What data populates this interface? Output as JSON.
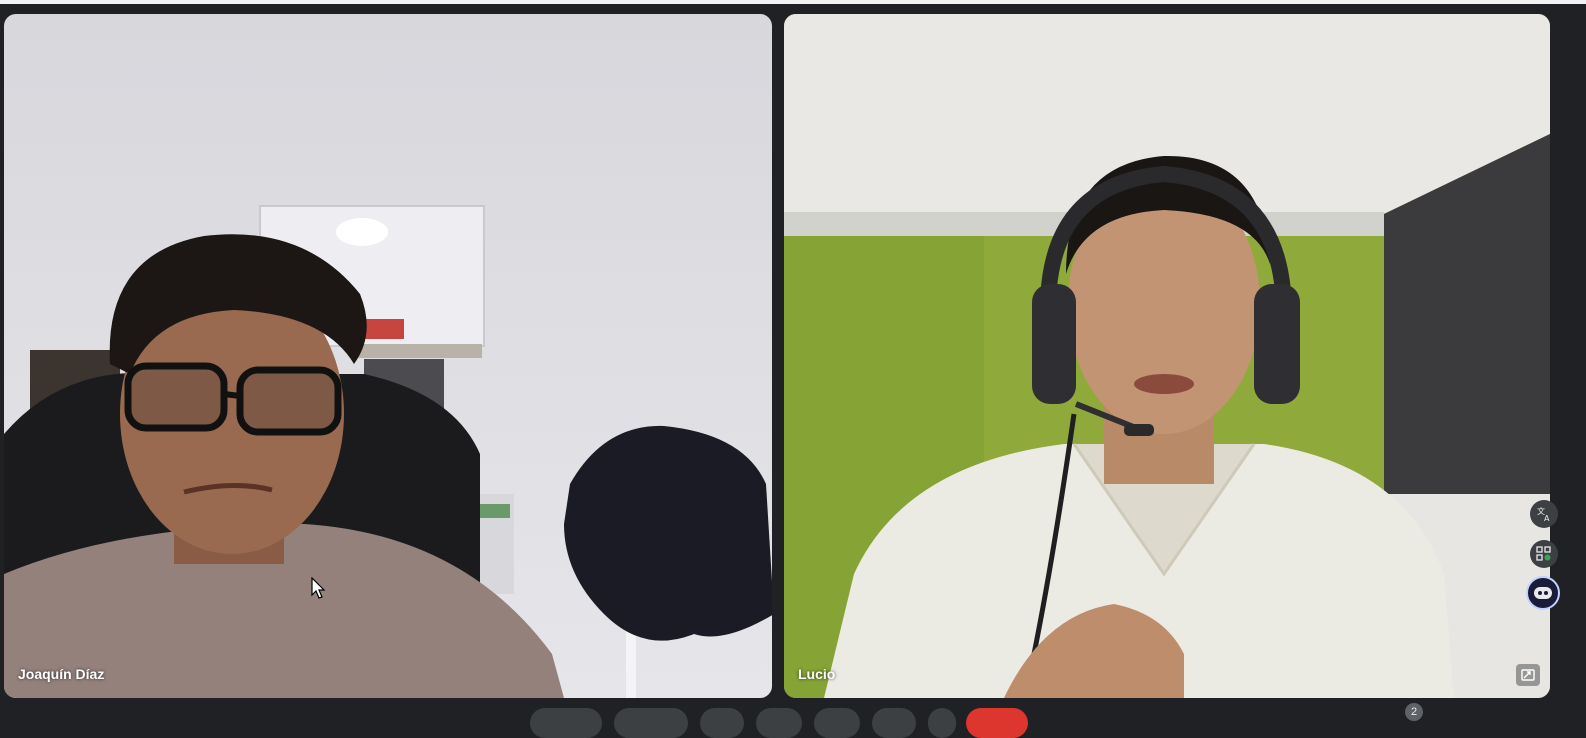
{
  "participants": [
    {
      "name": "Joaquín Díaz"
    },
    {
      "name": "Lucio"
    }
  ],
  "participant_count_badge": "2",
  "colors": {
    "background": "#202124",
    "active_speaker_border": "#a8c7fa",
    "end_call": "#dc362e"
  },
  "icons": [
    "translate-icon",
    "apps-icon",
    "gemini-assistant-icon",
    "picture-in-picture-icon",
    "cursor-pointer"
  ]
}
